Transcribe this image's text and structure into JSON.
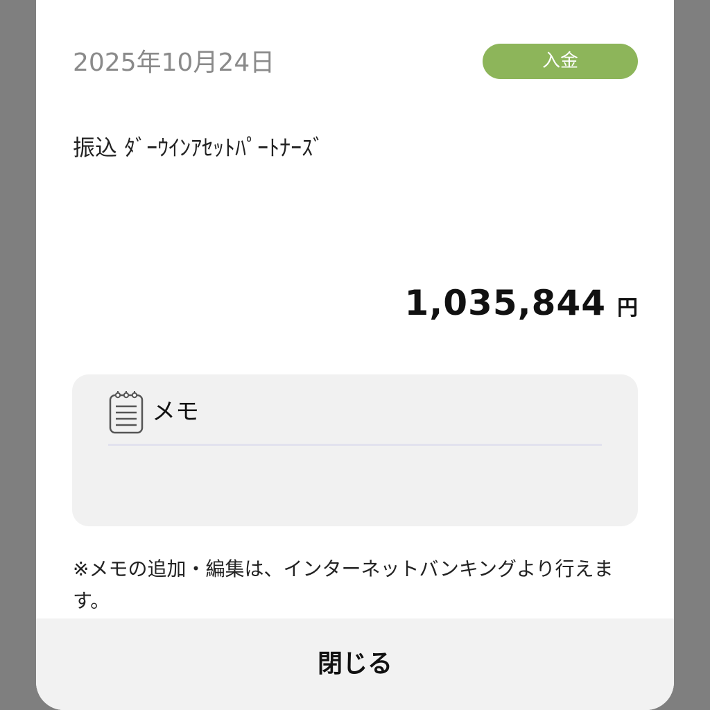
{
  "transaction": {
    "date": "2025年10月24日",
    "type_badge": "入金",
    "description": "振込 ﾀﾞｰｳｲﾝｱｾｯﾄﾊﾟｰﾄﾅｰｽﾞ",
    "amount": "1,035,844",
    "currency": "円"
  },
  "memo": {
    "title": "メモ",
    "icon": "notepad-icon"
  },
  "note": "※メモの追加・編集は、インターネットバンキングより行えます。",
  "close_button": {
    "label": "閉じる"
  },
  "colors": {
    "badge": "#8db55a",
    "backdrop": "#7f7f7f",
    "modal": "#ffffff",
    "memo_bg": "#f1f1f1"
  }
}
